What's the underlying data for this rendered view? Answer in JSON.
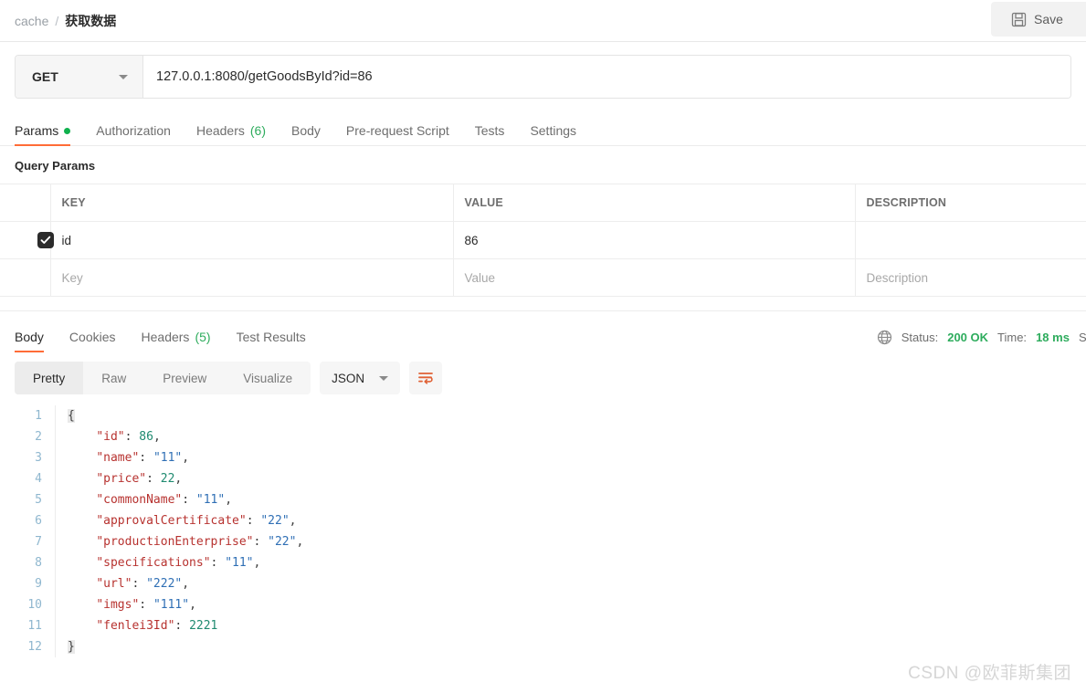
{
  "header": {
    "breadcrumb_collection": "cache",
    "breadcrumb_separator": "/",
    "breadcrumb_current": "获取数据",
    "save_label": "Save",
    "save_icon": "floppy-disk-icon"
  },
  "request": {
    "method": "GET",
    "method_caret_icon": "chevron-down-icon",
    "url": "127.0.0.1:8080/getGoodsById?id=86",
    "tabs": [
      {
        "label": "Params",
        "has_dot": true,
        "active": true
      },
      {
        "label": "Authorization",
        "active": false
      },
      {
        "label": "Headers",
        "count": "(6)",
        "active": false
      },
      {
        "label": "Body",
        "active": false
      },
      {
        "label": "Pre-request Script",
        "active": false
      },
      {
        "label": "Tests",
        "active": false
      },
      {
        "label": "Settings",
        "active": false
      }
    ]
  },
  "query_params": {
    "section_title": "Query Params",
    "columns": [
      "KEY",
      "VALUE",
      "DESCRIPTION"
    ],
    "rows": [
      {
        "checked": true,
        "key": "id",
        "value": "86",
        "description": ""
      }
    ],
    "placeholder_row": {
      "key": "Key",
      "value": "Value",
      "description": "Description"
    }
  },
  "response": {
    "tabs": [
      {
        "label": "Body",
        "active": true
      },
      {
        "label": "Cookies",
        "active": false
      },
      {
        "label": "Headers",
        "count": "(5)",
        "active": false
      },
      {
        "label": "Test Results",
        "active": false
      }
    ],
    "meta": {
      "globe_icon": "globe-icon",
      "status_label": "Status:",
      "status_value": "200 OK",
      "time_label": "Time:",
      "time_value": "18 ms",
      "size_label": "Siz"
    },
    "viewer": {
      "modes": [
        {
          "label": "Pretty",
          "active": true
        },
        {
          "label": "Raw",
          "active": false
        },
        {
          "label": "Preview",
          "active": false
        },
        {
          "label": "Visualize",
          "active": false
        }
      ],
      "format": "JSON",
      "format_caret_icon": "chevron-down-icon",
      "wrap_icon": "wrap-text-icon"
    },
    "body_lines": [
      {
        "no": "1",
        "tokens": [
          {
            "t": "brace",
            "v": "{"
          }
        ]
      },
      {
        "no": "2",
        "tokens": [
          {
            "t": "p",
            "v": "    "
          },
          {
            "t": "k",
            "v": "\"id\""
          },
          {
            "t": "p",
            "v": ": "
          },
          {
            "t": "n",
            "v": "86"
          },
          {
            "t": "p",
            "v": ","
          }
        ]
      },
      {
        "no": "3",
        "tokens": [
          {
            "t": "p",
            "v": "    "
          },
          {
            "t": "k",
            "v": "\"name\""
          },
          {
            "t": "p",
            "v": ": "
          },
          {
            "t": "s",
            "v": "\"11\""
          },
          {
            "t": "p",
            "v": ","
          }
        ]
      },
      {
        "no": "4",
        "tokens": [
          {
            "t": "p",
            "v": "    "
          },
          {
            "t": "k",
            "v": "\"price\""
          },
          {
            "t": "p",
            "v": ": "
          },
          {
            "t": "n",
            "v": "22"
          },
          {
            "t": "p",
            "v": ","
          }
        ]
      },
      {
        "no": "5",
        "tokens": [
          {
            "t": "p",
            "v": "    "
          },
          {
            "t": "k",
            "v": "\"commonName\""
          },
          {
            "t": "p",
            "v": ": "
          },
          {
            "t": "s",
            "v": "\"11\""
          },
          {
            "t": "p",
            "v": ","
          }
        ]
      },
      {
        "no": "6",
        "tokens": [
          {
            "t": "p",
            "v": "    "
          },
          {
            "t": "k",
            "v": "\"approvalCertificate\""
          },
          {
            "t": "p",
            "v": ": "
          },
          {
            "t": "s",
            "v": "\"22\""
          },
          {
            "t": "p",
            "v": ","
          }
        ]
      },
      {
        "no": "7",
        "tokens": [
          {
            "t": "p",
            "v": "    "
          },
          {
            "t": "k",
            "v": "\"productionEnterprise\""
          },
          {
            "t": "p",
            "v": ": "
          },
          {
            "t": "s",
            "v": "\"22\""
          },
          {
            "t": "p",
            "v": ","
          }
        ]
      },
      {
        "no": "8",
        "tokens": [
          {
            "t": "p",
            "v": "    "
          },
          {
            "t": "k",
            "v": "\"specifications\""
          },
          {
            "t": "p",
            "v": ": "
          },
          {
            "t": "s",
            "v": "\"11\""
          },
          {
            "t": "p",
            "v": ","
          }
        ]
      },
      {
        "no": "9",
        "tokens": [
          {
            "t": "p",
            "v": "    "
          },
          {
            "t": "k",
            "v": "\"url\""
          },
          {
            "t": "p",
            "v": ": "
          },
          {
            "t": "s",
            "v": "\"222\""
          },
          {
            "t": "p",
            "v": ","
          }
        ]
      },
      {
        "no": "10",
        "tokens": [
          {
            "t": "p",
            "v": "    "
          },
          {
            "t": "k",
            "v": "\"imgs\""
          },
          {
            "t": "p",
            "v": ": "
          },
          {
            "t": "s",
            "v": "\"111\""
          },
          {
            "t": "p",
            "v": ","
          }
        ]
      },
      {
        "no": "11",
        "tokens": [
          {
            "t": "p",
            "v": "    "
          },
          {
            "t": "k",
            "v": "\"fenlei3Id\""
          },
          {
            "t": "p",
            "v": ": "
          },
          {
            "t": "n",
            "v": "2221"
          }
        ]
      },
      {
        "no": "12",
        "tokens": [
          {
            "t": "brace",
            "v": "}"
          }
        ]
      }
    ],
    "body_json": {
      "id": 86,
      "name": "11",
      "price": 22,
      "commonName": "11",
      "approvalCertificate": "22",
      "productionEnterprise": "22",
      "specifications": "11",
      "url": "222",
      "imgs": "111",
      "fenlei3Id": 2221
    }
  },
  "watermark": "CSDN @欧菲斯集团",
  "colors": {
    "accent": "#ff6c37",
    "success": "#2eac5d",
    "dot": "#0fb14d",
    "key": "#b7322f",
    "string": "#2f6fb5",
    "number": "#1f8a70"
  }
}
